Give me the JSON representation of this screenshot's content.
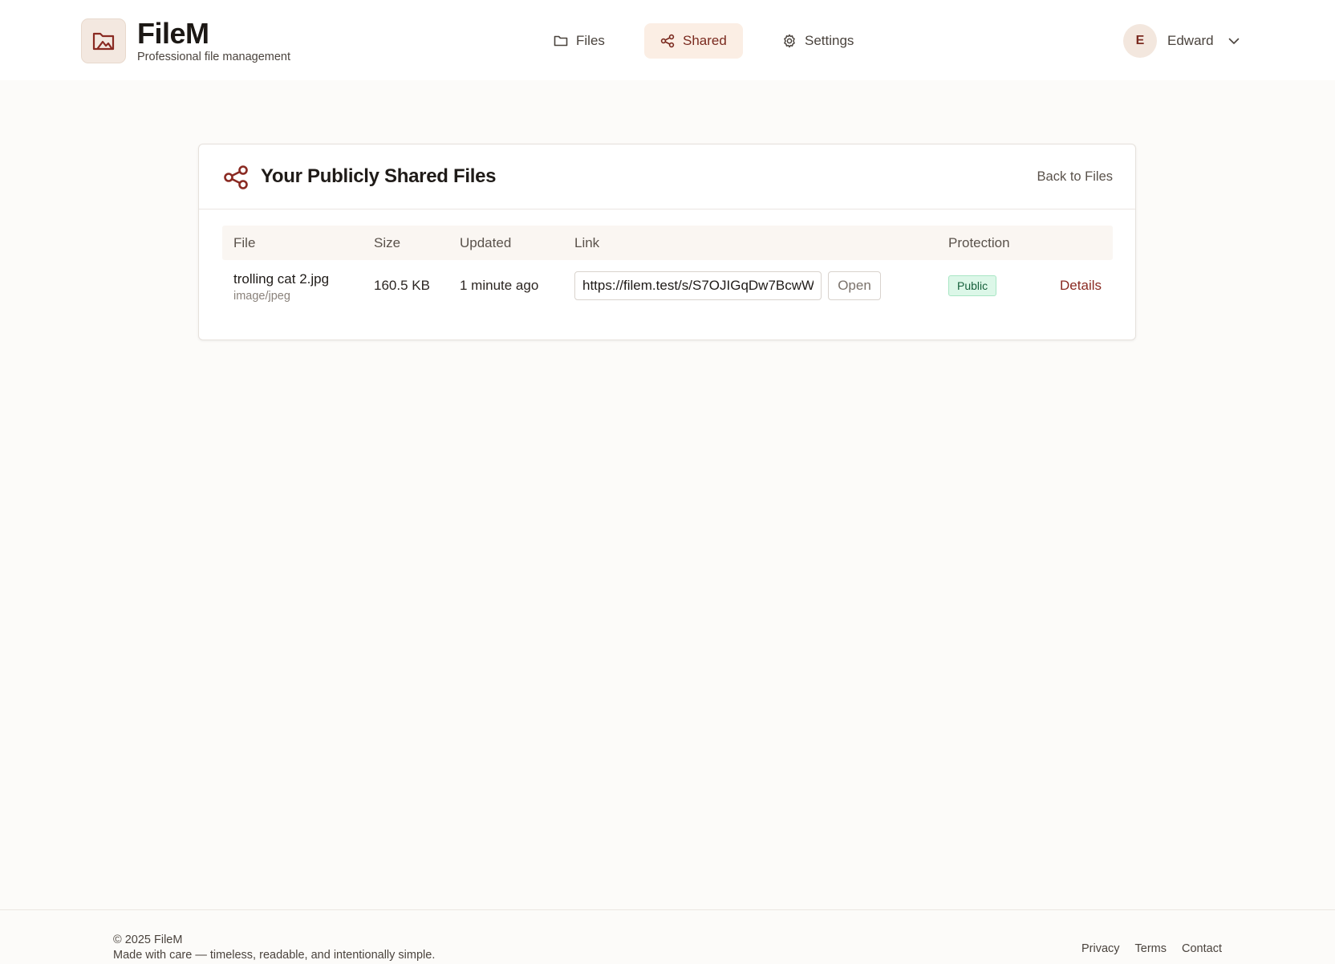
{
  "brand": {
    "name": "FileM",
    "tagline": "Professional file management"
  },
  "nav": {
    "files": "Files",
    "shared": "Shared",
    "settings": "Settings"
  },
  "user": {
    "initial": "E",
    "name": "Edward"
  },
  "card": {
    "title": "Your Publicly Shared Files",
    "back_link": "Back to Files"
  },
  "table": {
    "headers": {
      "file": "File",
      "size": "Size",
      "updated": "Updated",
      "link": "Link",
      "protection": "Protection"
    },
    "rows": [
      {
        "name": "trolling cat 2.jpg",
        "type": "image/jpeg",
        "size": "160.5 KB",
        "updated": "1 minute ago",
        "link": "https://filem.test/s/S7OJIGqDw7BcwW",
        "open_label": "Open",
        "protection": "Public",
        "details_label": "Details"
      }
    ]
  },
  "footer": {
    "copyright": "© 2025 FileM",
    "tagline": "Made with care — timeless, readable, and intentionally simple.",
    "links": [
      "Privacy",
      "Terms",
      "Contact"
    ]
  },
  "colors": {
    "accent": "#7a2a1f",
    "nav_active_bg": "#fbeee4",
    "badge_public_bg": "#dcf7e8",
    "badge_public_text": "#17603c"
  },
  "icons": {
    "logo": "folder-image-icon",
    "files": "folder-icon",
    "shared": "share-icon",
    "settings": "gear-icon",
    "dropdown": "chevron-down-icon",
    "card": "share-icon"
  }
}
